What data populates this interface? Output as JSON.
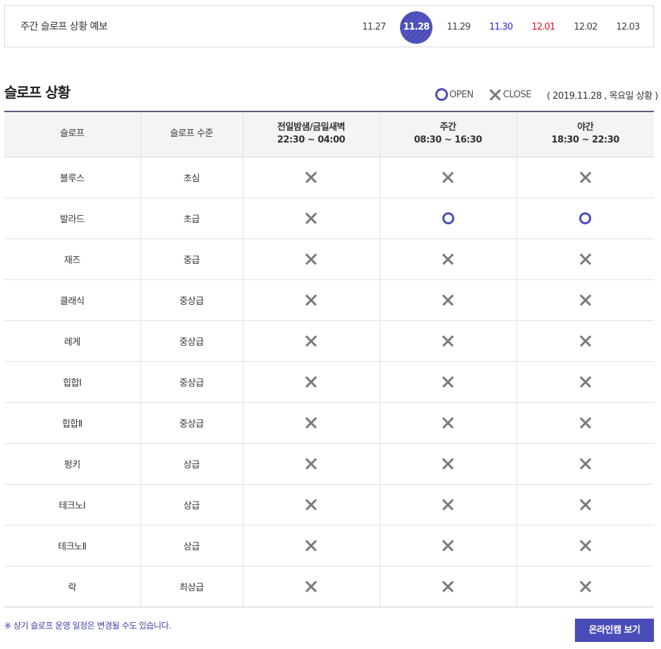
{
  "forecast": {
    "title": "주간 슬로프 상황 예보",
    "dates": [
      {
        "label": "11.27",
        "state": "normal"
      },
      {
        "label": "11.28",
        "state": "active"
      },
      {
        "label": "11.29",
        "state": "normal"
      },
      {
        "label": "11.30",
        "state": "saturday"
      },
      {
        "label": "12.01",
        "state": "sunday"
      },
      {
        "label": "12.02",
        "state": "normal"
      },
      {
        "label": "12.03",
        "state": "normal"
      }
    ]
  },
  "section": {
    "title": "슬로프 상황",
    "legend_open": "OPEN",
    "legend_close": "CLOSE",
    "status_date": "( 2019.11.28 , 목요일 상황 )"
  },
  "table": {
    "headers": {
      "slope": "슬로프",
      "level": "슬로프 수준",
      "night_title": "전일밤샘/금일새벽",
      "night_time": "22:30 ~ 04:00",
      "day_title": "주간",
      "day_time": "08:30 ~ 16:30",
      "evening_title": "야간",
      "evening_time": "18:30 ~ 22:30"
    },
    "rows": [
      {
        "slope": "블루스",
        "level": "초심",
        "night": "close",
        "day": "close",
        "evening": "close"
      },
      {
        "slope": "발라드",
        "level": "초급",
        "night": "close",
        "day": "open",
        "evening": "open"
      },
      {
        "slope": "재즈",
        "level": "중급",
        "night": "close",
        "day": "close",
        "evening": "close"
      },
      {
        "slope": "클래식",
        "level": "중상급",
        "night": "close",
        "day": "close",
        "evening": "close"
      },
      {
        "slope": "레게",
        "level": "중상급",
        "night": "close",
        "day": "close",
        "evening": "close"
      },
      {
        "slope": "힙합Ⅰ",
        "level": "중상급",
        "night": "close",
        "day": "close",
        "evening": "close"
      },
      {
        "slope": "힙합Ⅱ",
        "level": "중상급",
        "night": "close",
        "day": "close",
        "evening": "close"
      },
      {
        "slope": "펑키",
        "level": "상급",
        "night": "close",
        "day": "close",
        "evening": "close"
      },
      {
        "slope": "테크노Ⅰ",
        "level": "상급",
        "night": "close",
        "day": "close",
        "evening": "close"
      },
      {
        "slope": "테크노Ⅱ",
        "level": "상급",
        "night": "close",
        "day": "close",
        "evening": "close"
      },
      {
        "slope": "락",
        "level": "최상급",
        "night": "close",
        "day": "close",
        "evening": "close"
      }
    ]
  },
  "notice": "※ 상기 슬로프 운영 일정은 변경될 수도 있습니다.",
  "webcam_button": "온라인캠 보기",
  "colors": {
    "accent": "#4a4cb8",
    "saturday": "#2a2ad6",
    "sunday": "#e0141e",
    "close_mark": "#7a7a7a"
  },
  "icons": {
    "open": "open-circle-icon",
    "close": "close-x-icon"
  }
}
